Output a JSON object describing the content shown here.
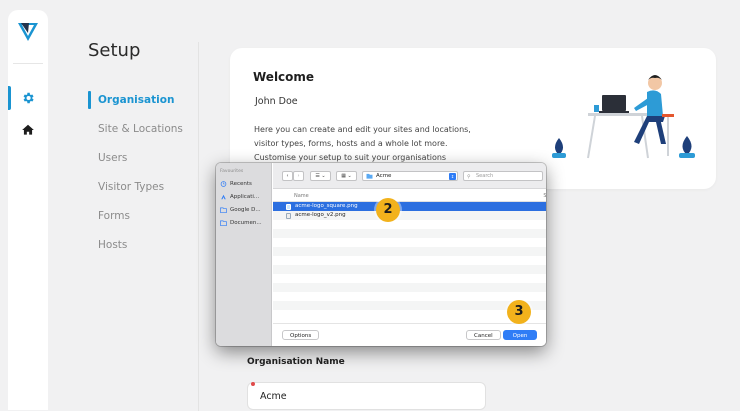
{
  "setup": {
    "title": "Setup",
    "nav": [
      {
        "label": "Organisation",
        "active": true
      },
      {
        "label": "Site & Locations",
        "active": false
      },
      {
        "label": "Users",
        "active": false
      },
      {
        "label": "Visitor Types",
        "active": false
      },
      {
        "label": "Forms",
        "active": false
      },
      {
        "label": "Hosts",
        "active": false
      }
    ]
  },
  "rail": {
    "logo_icon": "v-logo-icon",
    "items": [
      {
        "icon": "gear-icon",
        "active": true
      },
      {
        "icon": "home-icon",
        "active": false
      }
    ]
  },
  "welcome": {
    "title": "Welcome",
    "user": "John Doe",
    "description_lines": [
      "Here you can create and edit your sites and locations,",
      "visitor types, forms, hosts and a whole lot more.",
      "Customise your setup to suit your organisations needs."
    ]
  },
  "organisation": {
    "label": "Organisation Name",
    "value": "Acme"
  },
  "file_dialog": {
    "sidebar_heading": "Favourites",
    "favourites": [
      {
        "label": "Recents",
        "icon": "clock-icon"
      },
      {
        "label": "Applicati...",
        "icon": "applications-icon"
      },
      {
        "label": "Google D...",
        "icon": "folder-icon"
      },
      {
        "label": "Documen...",
        "icon": "folder-icon"
      }
    ],
    "location": "Acme",
    "search_placeholder": "Search",
    "columns": {
      "name": "Name",
      "size": "Si"
    },
    "files": [
      {
        "name": "acme-logo_square.png",
        "selected": true
      },
      {
        "name": "acme-logo_v2.png",
        "selected": false
      }
    ],
    "options_label": "Options",
    "cancel_label": "Cancel",
    "open_label": "Open"
  },
  "steps": {
    "step2": "2",
    "step3": "3"
  },
  "colors": {
    "accent": "#1a94d1",
    "selection": "#2c6fe0",
    "step_badge": "#f2b21c"
  }
}
